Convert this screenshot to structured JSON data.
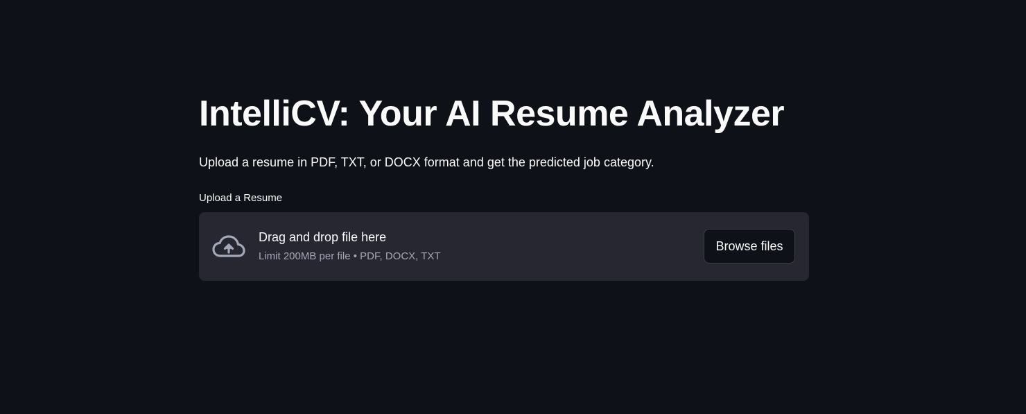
{
  "header": {
    "title": "IntelliCV: Your AI Resume Analyzer",
    "subtitle": "Upload a resume in PDF, TXT, or DOCX format and get the predicted job category."
  },
  "uploader": {
    "label": "Upload a Resume",
    "drop_text": "Drag and drop file here",
    "limit_text": "Limit 200MB per file • PDF, DOCX, TXT",
    "browse_label": "Browse files",
    "icon": "cloud-upload-icon"
  },
  "colors": {
    "background": "#0e1117",
    "dropzone": "#262730",
    "text": "#fafafa",
    "muted_text": "#a3a8b8"
  }
}
